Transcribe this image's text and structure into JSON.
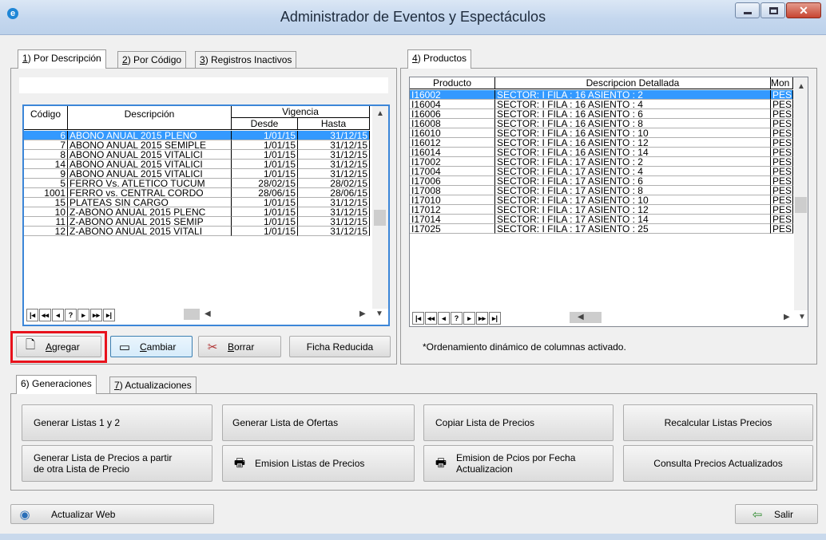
{
  "window": {
    "title": "Administrador de Eventos y Espectáculos"
  },
  "left_tabs": [
    {
      "key": "1",
      "rest": ") Por Descripción"
    },
    {
      "key": "2",
      "rest": ") Por Código"
    },
    {
      "key": "3",
      "rest": ") Registros Inactivos"
    }
  ],
  "right_tab": {
    "key": "4",
    "rest": ") Productos"
  },
  "events_grid": {
    "headers": {
      "codigo": "Código",
      "descripcion": "Descripción",
      "vigencia": "Vigencia",
      "desde": "Desde",
      "hasta": "Hasta"
    },
    "rows": [
      {
        "codigo": "6",
        "descripcion": "ABONO ANUAL 2015 PLENO",
        "desde": "1/01/15",
        "hasta": "31/12/15"
      },
      {
        "codigo": "7",
        "descripcion": "ABONO ANUAL 2015 SEMIPLE",
        "desde": "1/01/15",
        "hasta": "31/12/15"
      },
      {
        "codigo": "8",
        "descripcion": "ABONO ANUAL 2015 VITALICI",
        "desde": "1/01/15",
        "hasta": "31/12/15"
      },
      {
        "codigo": "14",
        "descripcion": "ABONO ANUAL 2015 VITALICI",
        "desde": "1/01/15",
        "hasta": "31/12/15"
      },
      {
        "codigo": "9",
        "descripcion": "ABONO ANUAL 2015 VITALICI",
        "desde": "1/01/15",
        "hasta": "31/12/15"
      },
      {
        "codigo": "5",
        "descripcion": "FERRO Vs. ATLETICO TUCUM",
        "desde": "28/02/15",
        "hasta": "28/02/15"
      },
      {
        "codigo": "1001",
        "descripcion": "FERRO vs. CENTRAL CORDO",
        "desde": "28/06/15",
        "hasta": "28/06/15"
      },
      {
        "codigo": "15",
        "descripcion": "PLATEAS SIN CARGO",
        "desde": "1/01/15",
        "hasta": "31/12/15"
      },
      {
        "codigo": "10",
        "descripcion": "Z-ABONO ANUAL 2015 PLENC",
        "desde": "1/01/15",
        "hasta": "31/12/15"
      },
      {
        "codigo": "11",
        "descripcion": "Z-ABONO ANUAL 2015 SEMIP",
        "desde": "1/01/15",
        "hasta": "31/12/15"
      },
      {
        "codigo": "12",
        "descripcion": "Z-ABONO ANUAL 2015 VITALI",
        "desde": "1/01/15",
        "hasta": "31/12/15"
      }
    ],
    "selected_index": 0
  },
  "products_grid": {
    "headers": {
      "producto": "Producto",
      "descripcion": "Descripcion Detallada",
      "moneda": "Mon"
    },
    "rows": [
      {
        "producto": "I16002",
        "descripcion": "SECTOR: I FILA : 16 ASIENTO : 2",
        "moneda": "PES"
      },
      {
        "producto": "I16004",
        "descripcion": "SECTOR: I FILA : 16 ASIENTO : 4",
        "moneda": "PES"
      },
      {
        "producto": "I16006",
        "descripcion": "SECTOR: I FILA : 16 ASIENTO : 6",
        "moneda": "PES"
      },
      {
        "producto": "I16008",
        "descripcion": "SECTOR: I FILA : 16 ASIENTO : 8",
        "moneda": "PES"
      },
      {
        "producto": "I16010",
        "descripcion": "SECTOR: I FILA : 16 ASIENTO : 10",
        "moneda": "PES"
      },
      {
        "producto": "I16012",
        "descripcion": "SECTOR: I FILA : 16 ASIENTO : 12",
        "moneda": "PES"
      },
      {
        "producto": "I16014",
        "descripcion": "SECTOR: I FILA : 16 ASIENTO : 14",
        "moneda": "PES"
      },
      {
        "producto": "I17002",
        "descripcion": "SECTOR: I FILA : 17 ASIENTO : 2",
        "moneda": "PES"
      },
      {
        "producto": "I17004",
        "descripcion": "SECTOR: I FILA : 17 ASIENTO : 4",
        "moneda": "PES"
      },
      {
        "producto": "I17006",
        "descripcion": "SECTOR: I FILA : 17 ASIENTO : 6",
        "moneda": "PES"
      },
      {
        "producto": "I17008",
        "descripcion": "SECTOR: I FILA : 17 ASIENTO : 8",
        "moneda": "PES"
      },
      {
        "producto": "I17010",
        "descripcion": "SECTOR: I FILA : 17 ASIENTO : 10",
        "moneda": "PES"
      },
      {
        "producto": "I17012",
        "descripcion": "SECTOR: I FILA : 17 ASIENTO : 12",
        "moneda": "PES"
      },
      {
        "producto": "I17014",
        "descripcion": "SECTOR: I FILA : 17 ASIENTO : 14",
        "moneda": "PES"
      },
      {
        "producto": "I17025",
        "descripcion": "SECTOR: I FILA : 17 ASIENTO : 25",
        "moneda": "PES"
      }
    ],
    "selected_index": 0
  },
  "nav_buttons": [
    "|◂",
    "◂◂",
    "◂",
    "?",
    "▸",
    "▸▸",
    "▸|"
  ],
  "event_buttons": {
    "agregar": {
      "key": "A",
      "rest": "gregar"
    },
    "cambiar": {
      "key": "C",
      "rest": "ambiar"
    },
    "borrar": {
      "key": "B",
      "rest": "orrar"
    },
    "ficha": "Ficha Reducida"
  },
  "products_note": "*Ordenamiento dinámico de columnas activado.",
  "bottom_tabs": [
    {
      "label": "6) Generaciones"
    },
    {
      "key": "7",
      "rest": ") Actualizaciones"
    }
  ],
  "generation_buttons": {
    "generar_1_2": "Generar Listas 1 y 2",
    "generar_ofertas": "Generar Lista  de Ofertas",
    "copiar": "Copiar Lista de Precios",
    "recalcular": "Recalcular Listas Precios",
    "generar_desde_otra_l1": "Generar Lista de Precios a partir",
    "generar_desde_otra_l2": "de otra Lista de Precio",
    "emision_listas": "Emision Listas de Precios",
    "emision_fecha_l1": "Emision de Pcios por Fecha",
    "emision_fecha_l2": "Actualizacion",
    "consulta": "Consulta  Precios Actualizados"
  },
  "footer": {
    "actualizar_web": "Actualizar Web",
    "salir": "Salir"
  },
  "colors": {
    "selection": "#3399ff",
    "highlight": "#e8121c",
    "focus_border": "#3c86d8"
  },
  "icons": {
    "app": "app-logo-icon",
    "agregar": "new-document-icon",
    "cambiar": "edit-window-icon",
    "borrar": "scissors-icon",
    "printer": "printer-icon",
    "web": "web-globe-icon",
    "salir": "exit-door-icon"
  }
}
